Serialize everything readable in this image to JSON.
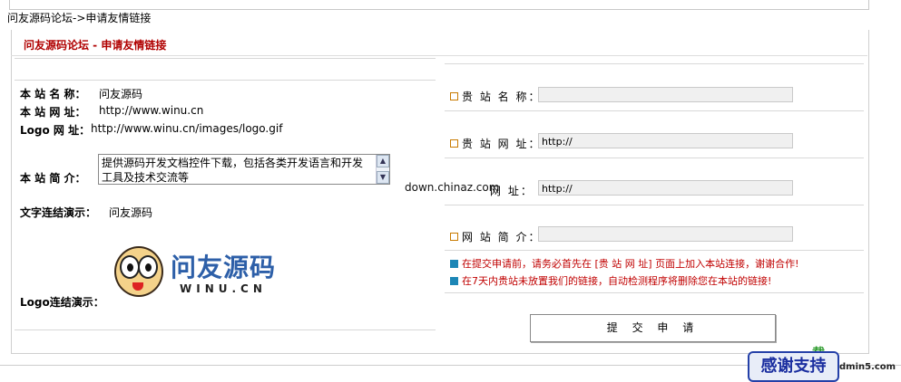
{
  "breadcrumb": "问友源码论坛->申请友情链接",
  "panel_title": "问友源码论坛 - 申请友情链接",
  "site_info": {
    "name_label": "本 站 名 称：",
    "name_value": "问友源码",
    "url_label": "本 站 网 址：",
    "url_value": "http://www.winu.cn",
    "logo_label": "Logo 网 址：",
    "logo_value": "http://www.winu.cn/images/logo.gif",
    "intro_label": "本 站 简 介：",
    "intro_value": "提供源码开发文档控件下载，包括各类开发语言和开发工具及技术交流等",
    "textlink_label": "文字连结演示：",
    "textlink_value": "问友源码",
    "logolink_label": "Logo连结演示："
  },
  "logo": {
    "cn": "问友源码",
    "en": "WINU.CN"
  },
  "form": {
    "name_label": "贵 站 名 称：",
    "name_value": "",
    "url_label": "贵 站 网 址：",
    "url_value": "http://",
    "logo_label": "网 址：",
    "logo_value": "http://",
    "intro_label": "网 站 简 介：",
    "intro_value": ""
  },
  "notes": [
    "在提交申请前，请务必首先在 [贵 站 网 址] 页面上加入本站连接，谢谢合作!",
    "在7天内贵站未放置我们的链接，自动检测程序将删除您在本站的链接!"
  ],
  "submit_label": "提 交 申 请",
  "watermark": "down.chinaz.com",
  "badge": "感谢支持",
  "corner_text": "载",
  "corner_domain": "dmin5.com"
}
